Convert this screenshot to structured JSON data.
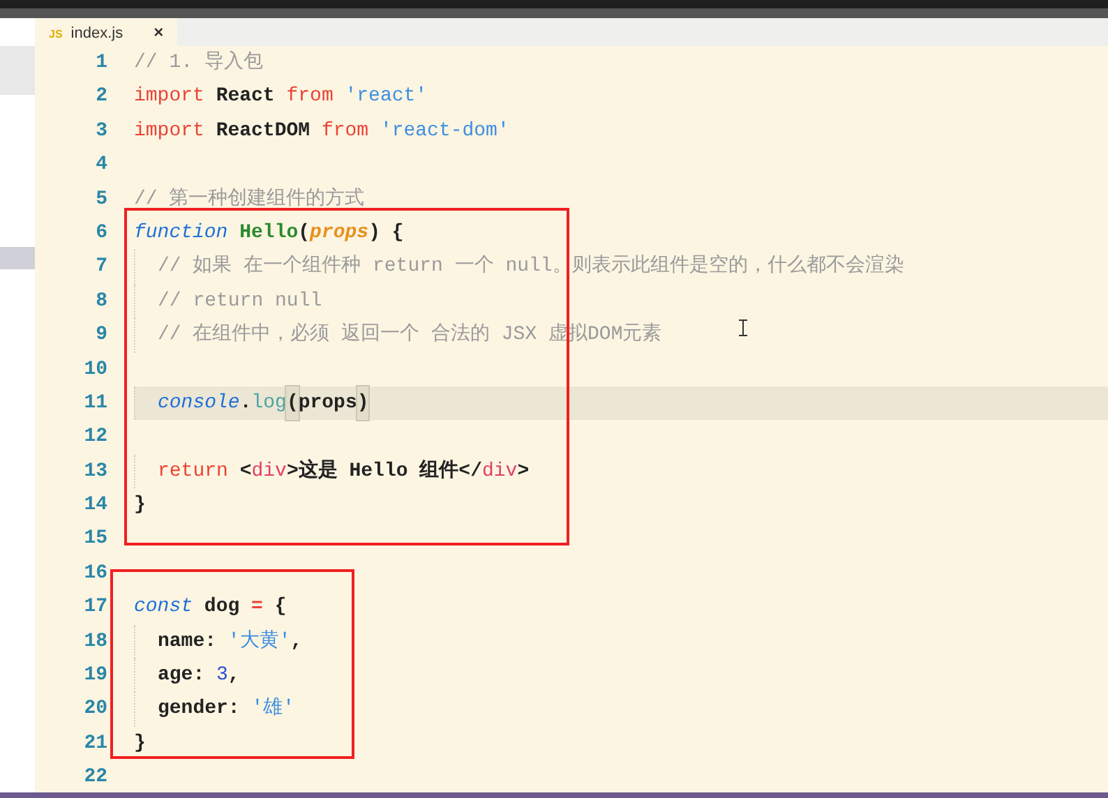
{
  "tab": {
    "icon_text": "JS",
    "label": "index.js",
    "close": "×",
    "selected": true
  },
  "blocks": [
    {
      "boxed": false,
      "lines": [
        {
          "num": "1",
          "tokens": [
            {
              "kind": "comment",
              "t": "// 1. 导入包"
            }
          ]
        },
        {
          "num": "2",
          "tokens": [
            {
              "kind": "keyword",
              "t": "import"
            },
            {
              "kind": "plain",
              "t": " React "
            },
            {
              "kind": "keyword",
              "t": "from"
            },
            {
              "kind": "string",
              "t": " 'react'"
            }
          ]
        },
        {
          "num": "3",
          "tokens": [
            {
              "kind": "keyword",
              "t": "import"
            },
            {
              "kind": "plain",
              "t": " ReactDOM "
            },
            {
              "kind": "keyword",
              "t": "from"
            },
            {
              "kind": "string",
              "t": " 'react-dom'"
            }
          ]
        },
        {
          "num": "4"
        },
        {
          "num": "5",
          "tokens": [
            {
              "kind": "comment",
              "t": "// 第一种创建组件的方式"
            }
          ]
        }
      ]
    },
    {
      "boxed": true,
      "lines": [
        {
          "num": "6",
          "tokens": [
            {
              "kind": "declare",
              "t": "function"
            },
            {
              "kind": "fname",
              "t": " Hello"
            },
            {
              "kind": "plain",
              "t": "("
            },
            {
              "kind": "param",
              "t": "props"
            },
            {
              "kind": "plain",
              "t": ") {"
            }
          ]
        },
        {
          "num": "7",
          "indent": true,
          "tokens": [
            {
              "kind": "comment",
              "t": "// 如果 在一个组件种 return 一个 null。则表示此组件是空的，什么都不会渲染"
            }
          ]
        },
        {
          "num": "8",
          "indent": true,
          "tokens": [
            {
              "kind": "comment",
              "t": "// return null"
            }
          ]
        },
        {
          "num": "9",
          "indent": true,
          "tokens": [
            {
              "kind": "comment",
              "t": "// 在组件中，必须 返回一个 合法的 JSX 虚拟DOM元素"
            }
          ]
        },
        {
          "num": "10"
        },
        {
          "num": "11",
          "indent": true,
          "current": true,
          "tokens": [
            {
              "kind": "declare",
              "t": "console"
            },
            {
              "kind": "plain",
              "t": "."
            },
            {
              "kind": "method",
              "t": "log"
            },
            {
              "kind": "bracket",
              "t": "("
            },
            {
              "kind": "plain",
              "t": "props"
            },
            {
              "kind": "bracket",
              "t": ")"
            }
          ]
        },
        {
          "num": "12"
        },
        {
          "num": "13",
          "indent": true,
          "tokens": [
            {
              "kind": "keyword",
              "t": "return"
            },
            {
              "kind": "plain",
              "t": " <"
            },
            {
              "kind": "tag",
              "t": "div"
            },
            {
              "kind": "plain",
              "t": ">这是 Hello 组件</"
            },
            {
              "kind": "tag",
              "t": "div"
            },
            {
              "kind": "plain",
              "t": ">"
            }
          ]
        },
        {
          "num": "14",
          "tokens": [
            {
              "kind": "plain",
              "t": "}"
            }
          ]
        },
        {
          "num": "15"
        }
      ]
    },
    {
      "boxed": true,
      "lines": [
        {
          "num": "16"
        },
        {
          "num": "17",
          "tokens": [
            {
              "kind": "declare",
              "t": "const"
            },
            {
              "kind": "plain",
              "t": " dog "
            },
            {
              "kind": "operator",
              "t": "="
            },
            {
              "kind": "plain",
              "t": " {"
            }
          ]
        },
        {
          "num": "18",
          "indent": true,
          "tokens": [
            {
              "kind": "plain",
              "t": "name: "
            },
            {
              "kind": "string",
              "t": "'大黄'"
            },
            {
              "kind": "plain",
              "t": ","
            }
          ]
        },
        {
          "num": "19",
          "indent": true,
          "tokens": [
            {
              "kind": "plain",
              "t": "age: "
            },
            {
              "kind": "number",
              "t": "3"
            },
            {
              "kind": "plain",
              "t": ","
            }
          ]
        },
        {
          "num": "20",
          "indent": true,
          "tokens": [
            {
              "kind": "plain",
              "t": "gender: "
            },
            {
              "kind": "string",
              "t": "'雄'"
            }
          ]
        },
        {
          "num": "21",
          "tokens": [
            {
              "kind": "plain",
              "t": "}"
            }
          ]
        }
      ]
    },
    {
      "boxed": false,
      "lines": [
        {
          "num": "22"
        }
      ]
    }
  ]
}
